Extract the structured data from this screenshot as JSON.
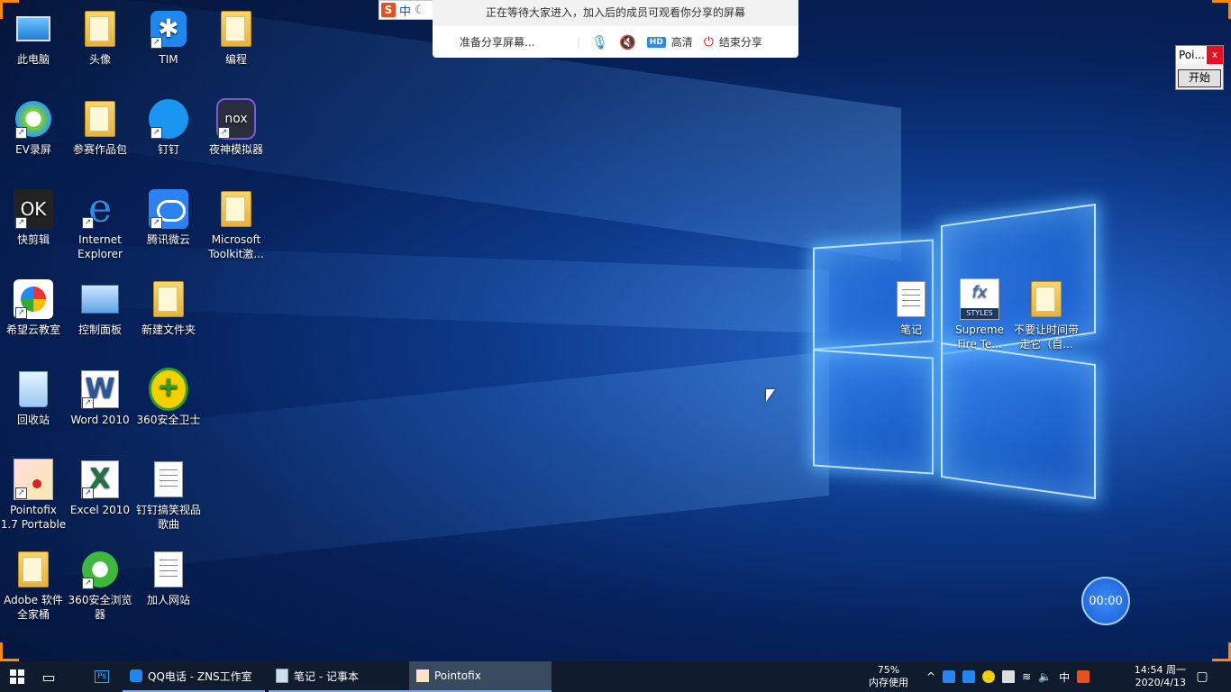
{
  "share_bar": {
    "status": "正在等待大家进入，加入后的成员可观看你分享的屏幕",
    "preparing": "准备分享屏幕...",
    "hd_badge": "HD",
    "hd_label": "高清",
    "end_label": "结束分享"
  },
  "ime": {
    "logo": "S",
    "mode": "中"
  },
  "pointofix_mini": {
    "title": "Poi...",
    "close": "x",
    "start_button": "开始"
  },
  "timer": {
    "value": "00:00"
  },
  "desktop_icons": [
    {
      "label": "此电脑"
    },
    {
      "label": "头像"
    },
    {
      "label": "TIM"
    },
    {
      "label": "编程"
    },
    {
      "label": "EV录屏"
    },
    {
      "label": "参赛作品包"
    },
    {
      "label": "钉钉"
    },
    {
      "label": "夜神模拟器"
    },
    {
      "label": "快剪辑"
    },
    {
      "label": "Internet Explorer"
    },
    {
      "label": "腾讯微云"
    },
    {
      "label": "Microsoft Toolkit激..."
    },
    {
      "label": "希望云教室"
    },
    {
      "label": "控制面板"
    },
    {
      "label": "新建文件夹"
    },
    {
      "label": "回收站"
    },
    {
      "label": "Word 2010"
    },
    {
      "label": "360安全卫士"
    },
    {
      "label": "Pointofix 1.7 Portable"
    },
    {
      "label": "Excel 2010"
    },
    {
      "label": "钉钉搞笑视品歌曲"
    },
    {
      "label": "Adobe 软件全家桶"
    },
    {
      "label": "360安全浏览器"
    },
    {
      "label": "加人网站"
    },
    {
      "label": "笔记"
    },
    {
      "label": "Supreme Fire Te..."
    },
    {
      "label": "不要让时间带走它（自..."
    }
  ],
  "icon_glyphs": {
    "tim": "✱",
    "nox": "nox",
    "fx": "fx",
    "fx_sub": "STYLES",
    "ps": "Ps"
  },
  "taskbar": {
    "tasks": [
      {
        "label": "QQ电话 - ZNS工作室"
      },
      {
        "label": "笔记 - 记事本"
      },
      {
        "label": "Pointofix"
      }
    ],
    "memory_percent": "75%",
    "memory_label": "内存使用",
    "ime_tray": "中",
    "time": "14:54 周一",
    "date": "2020/4/13"
  },
  "colors": {
    "accent": "#ff8a00",
    "taskbar": "#101b2e",
    "end_red": "#e02020",
    "hd_blue": "#2a8be8"
  }
}
